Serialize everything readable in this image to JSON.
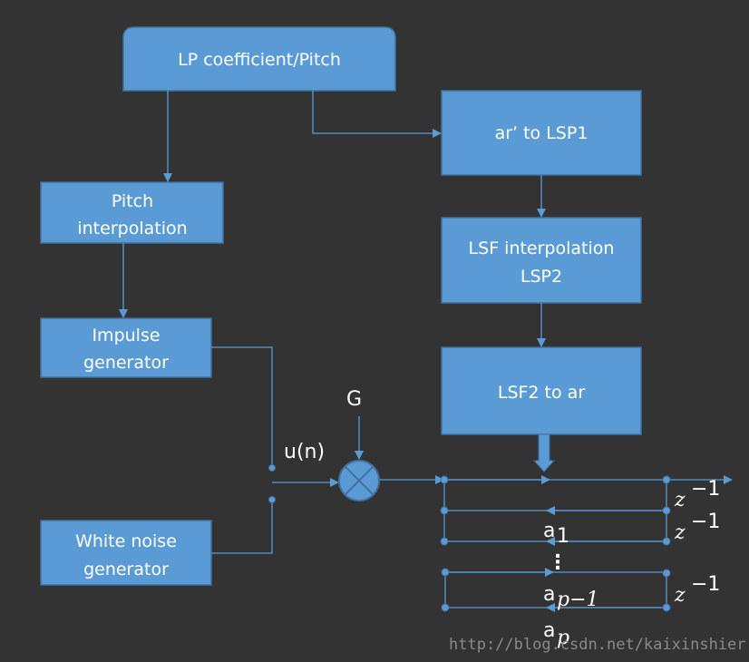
{
  "blocks": {
    "lp": "LP coefficient/Pitch",
    "ar_lsp1": "ar’ to LSP1",
    "pitch_1": "Pitch",
    "pitch_2": "interpolation",
    "lsf_1": "LSF interpolation",
    "lsf_2": "LSP2",
    "impulse_1": "Impulse",
    "impulse_2": "generator",
    "lsf2ar": "LSF2 to ar",
    "noise_1": "White noise",
    "noise_2": "generator"
  },
  "labels": {
    "gain": "G",
    "excitation": "u(n)",
    "delay": "z",
    "delay_exp": "−1",
    "a": "a",
    "a1_sub": "1",
    "ap1_sub": "p−1",
    "ap_sub": "p",
    "ellipsis": "⋮"
  },
  "watermark": "http://blog.csdn.net/kaixinshier",
  "colors": {
    "background": "#333333",
    "block": "#5b9bd5",
    "border": "#41719c"
  }
}
